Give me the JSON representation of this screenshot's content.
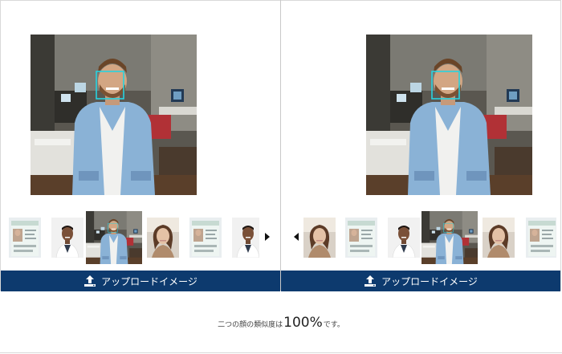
{
  "colors": {
    "upload_bar": "#0d3a6e",
    "face_box": "#27d3e0",
    "divider": "#c8c8c8"
  },
  "left_panel": {
    "main_image": "man-office-photo",
    "thumbnails": [
      "id-card-photo",
      "man-portrait-photo",
      "man-office-photo",
      "woman-selfie-photo",
      "id-card-photo",
      "man-portrait-photo"
    ],
    "selected_index": 2,
    "next_icon": "caret-right-icon",
    "upload_label": "アップロードイメージ",
    "upload_icon": "upload-icon"
  },
  "right_panel": {
    "main_image": "man-office-photo",
    "thumbnails": [
      "woman-selfie-photo",
      "id-card-photo",
      "man-portrait-photo",
      "man-office-photo",
      "woman-selfie-photo",
      "id-card-photo"
    ],
    "selected_index": 3,
    "prev_icon": "caret-left-icon",
    "upload_label": "アップロードイメージ",
    "upload_icon": "upload-icon"
  },
  "result": {
    "prefix": "二つの顔の類似度は",
    "percentage": "100%",
    "suffix": "です。"
  }
}
